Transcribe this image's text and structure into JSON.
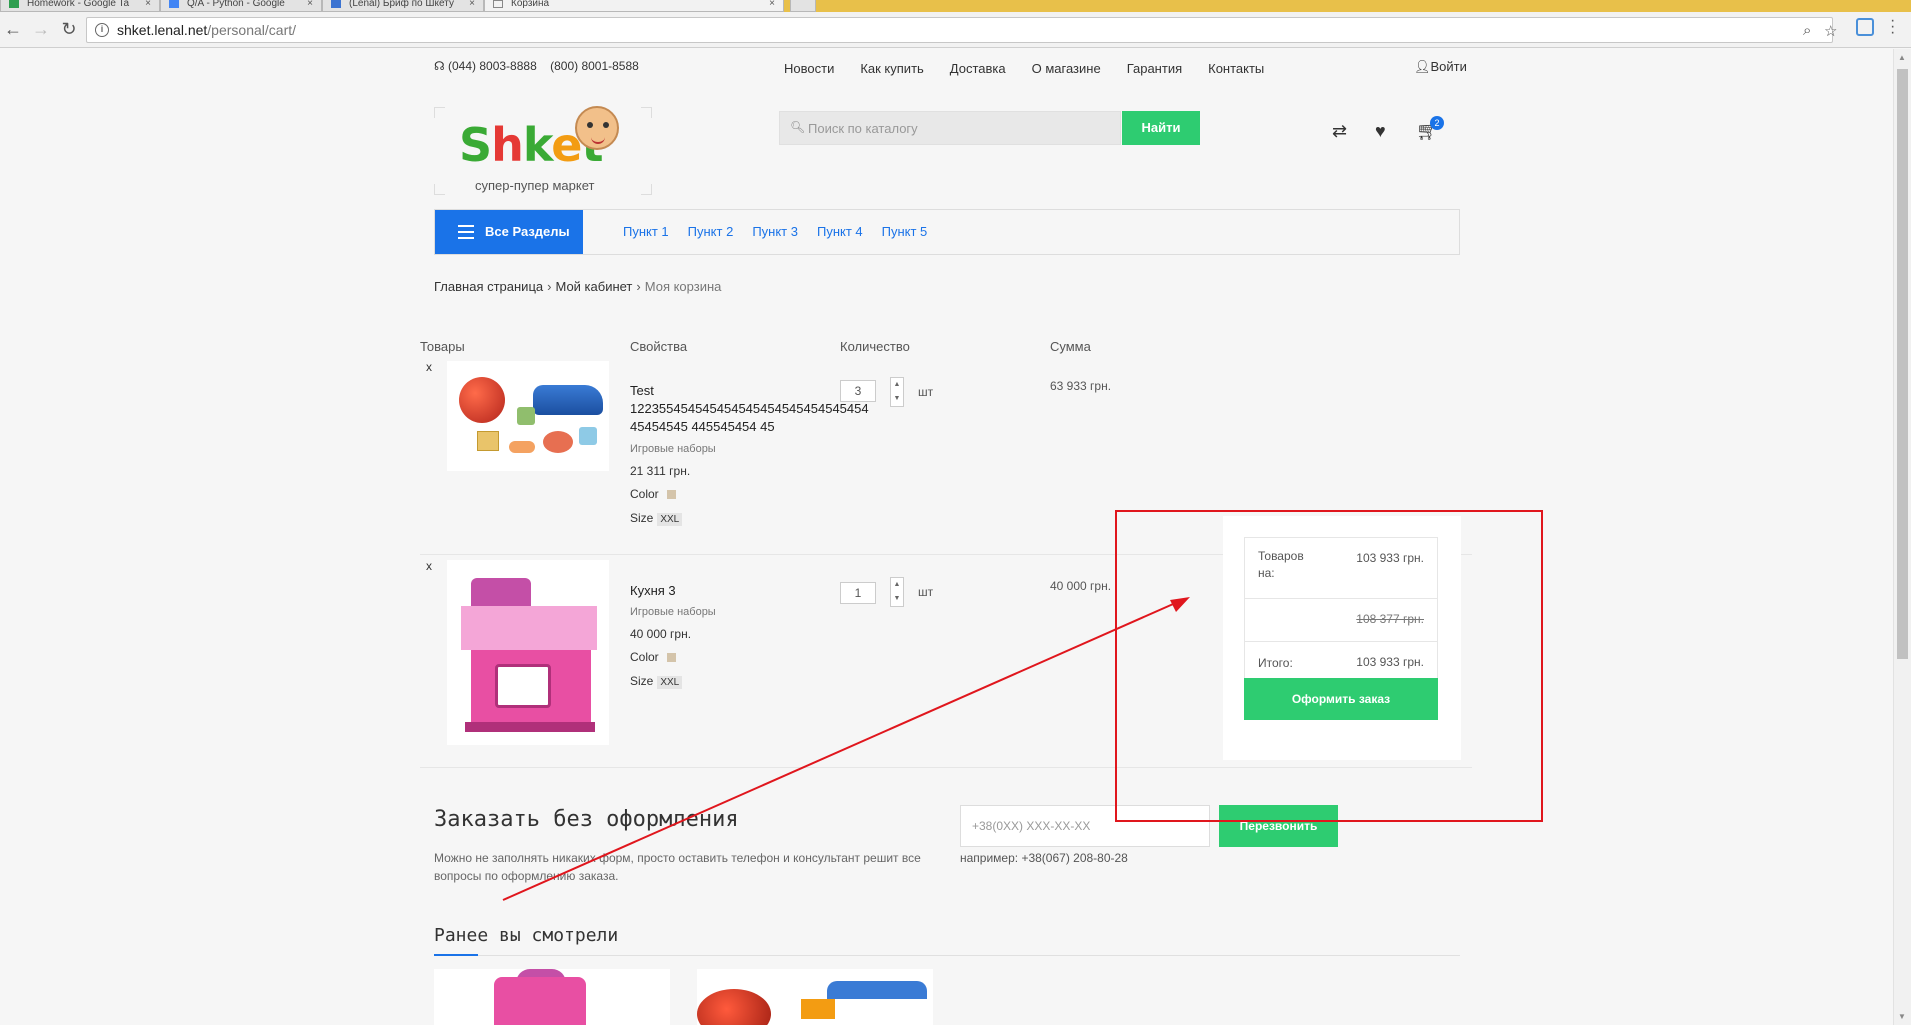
{
  "browser": {
    "tabs": [
      {
        "label": "Homework - Google Ta"
      },
      {
        "label": "Q/A - Python - Google"
      },
      {
        "label": "(Lenal) Бриф по Шкету"
      },
      {
        "label": "Корзина"
      }
    ],
    "url_host": "shket.lenal.net",
    "url_path": "/personal/cart/"
  },
  "header": {
    "phone1": "(044) 8003-8888",
    "phone2": "(800) 8001-8588",
    "nav": [
      "Новости",
      "Как купить",
      "Доставка",
      "О магазине",
      "Гарантия",
      "Контакты"
    ],
    "login": "Войти",
    "logo_text": "Shket",
    "logo_subtitle": "супер-пупер маркет",
    "search_placeholder": "Поиск по каталогу",
    "search_button": "Найти",
    "cart_count": "2"
  },
  "menu": {
    "all_sections": "Все Разделы",
    "items": [
      "Пункт 1",
      "Пункт 2",
      "Пункт 3",
      "Пункт 4",
      "Пункт 5"
    ]
  },
  "breadcrumb": {
    "items": [
      "Главная страница",
      "Мой кабинет"
    ],
    "current": "Моя корзина"
  },
  "cart": {
    "columns": [
      "Товары",
      "Свойства",
      "Количество",
      "Сумма"
    ],
    "items": [
      {
        "remove": "x",
        "name_line1": "Test",
        "name_line2": "122355454545454545454545454545454",
        "name_line3": "45454545 445545454 45",
        "category": "Игровые наборы",
        "price": "21 311 грн.",
        "color_label": "Color",
        "size_label": "Size",
        "size_value": "XXL",
        "quantity": "3",
        "unit": "шт",
        "sum": "63 933 грн."
      },
      {
        "remove": "x",
        "name_line1": "Кухня 3",
        "category": "Игровые наборы",
        "price": "40 000 грн.",
        "color_label": "Color",
        "size_label": "Size",
        "size_value": "XXL",
        "quantity": "1",
        "unit": "шт",
        "sum": "40 000 грн."
      }
    ],
    "color_swatch": "#d4c4aa"
  },
  "summary": {
    "goods_label": "Товаров на:",
    "goods_value": "103 933 грн.",
    "old_value": "108 377 грн.",
    "total_label": "Итого:",
    "total_value": "103 933 грн.",
    "order_button": "Оформить заказ"
  },
  "quick_order": {
    "title": "Заказать без оформления",
    "description": "Можно не заполнять никаких форм, просто оставить телефон и консультант решит все вопросы по оформлению заказа.",
    "phone_placeholder": "+38(0XX) XXX-XX-XX",
    "callback_button": "Перезвонить",
    "example": "например: +38(067) 208-80-28"
  },
  "viewed": {
    "title": "Ранее вы смотрели"
  },
  "colors": {
    "accent_blue": "#1a73e8",
    "accent_green": "#2ecc71",
    "annotation_red": "#e0161d"
  }
}
